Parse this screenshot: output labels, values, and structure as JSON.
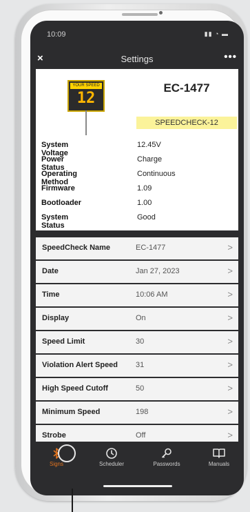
{
  "status_bar": {
    "time": "10:09",
    "icons": "▮▮ ◔ ▬"
  },
  "navbar": {
    "close_icon": "×",
    "title": "Settings",
    "more_icon": "•••"
  },
  "device": {
    "sign_header": "YOUR SPEED",
    "sign_digits": "12",
    "name": "EC-1477",
    "model": "SPEEDCHECK-12",
    "info": [
      {
        "label": "System Voltage",
        "value": "12.45V"
      },
      {
        "label": "Power Status",
        "value": "Charge"
      },
      {
        "label": "Operating Method",
        "value": "Continuous"
      },
      {
        "label": "Firmware",
        "value": "1.09"
      },
      {
        "label": "Bootloader",
        "value": "1.00"
      },
      {
        "label": "System Status",
        "value": "Good"
      }
    ]
  },
  "settings": [
    {
      "label": "SpeedCheck Name",
      "value": "EC-1477"
    },
    {
      "label": "Date",
      "value": "Jan 27, 2023"
    },
    {
      "label": "Time",
      "value": "10:06 AM"
    },
    {
      "label": "Display",
      "value": "On"
    },
    {
      "label": "Speed Limit",
      "value": "30"
    },
    {
      "label": "Violation Alert Speed",
      "value": "31"
    },
    {
      "label": "High Speed Cutoff",
      "value": "50"
    },
    {
      "label": "Minimum Speed",
      "value": "198"
    },
    {
      "label": "Strobe",
      "value": "Off"
    }
  ],
  "chevron": ">",
  "tabs": [
    {
      "label": "Signs",
      "icon": "bluetooth-icon",
      "active": true
    },
    {
      "label": "Scheduler",
      "icon": "clock-icon",
      "active": false
    },
    {
      "label": "Passwords",
      "icon": "key-icon",
      "active": false
    },
    {
      "label": "Manuals",
      "icon": "book-icon",
      "active": false
    }
  ],
  "colors": {
    "accent": "#e2741f",
    "badge": "#fbf39a",
    "sign_digits": "#ffb600",
    "screen_bg": "#2c2c2e"
  }
}
